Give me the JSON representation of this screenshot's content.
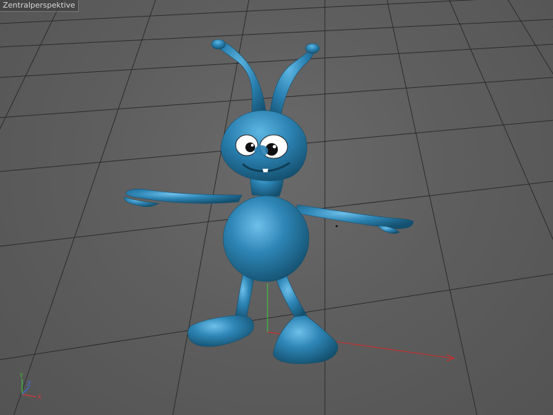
{
  "viewport": {
    "label": "Zentralperspektive"
  },
  "axis_gizmo": {
    "x_label": "X",
    "y_label": "Y",
    "z_label": "Z"
  },
  "colors": {
    "grid": "#2a2a2a",
    "character": "#2e86b6",
    "x_axis": "#d23a3a",
    "y_axis": "#3fbf3f",
    "z_axis": "#3a6fd8"
  },
  "icons": {
    "character": "blue-alien-character",
    "gizmo": "axis-gizmo-icon"
  }
}
